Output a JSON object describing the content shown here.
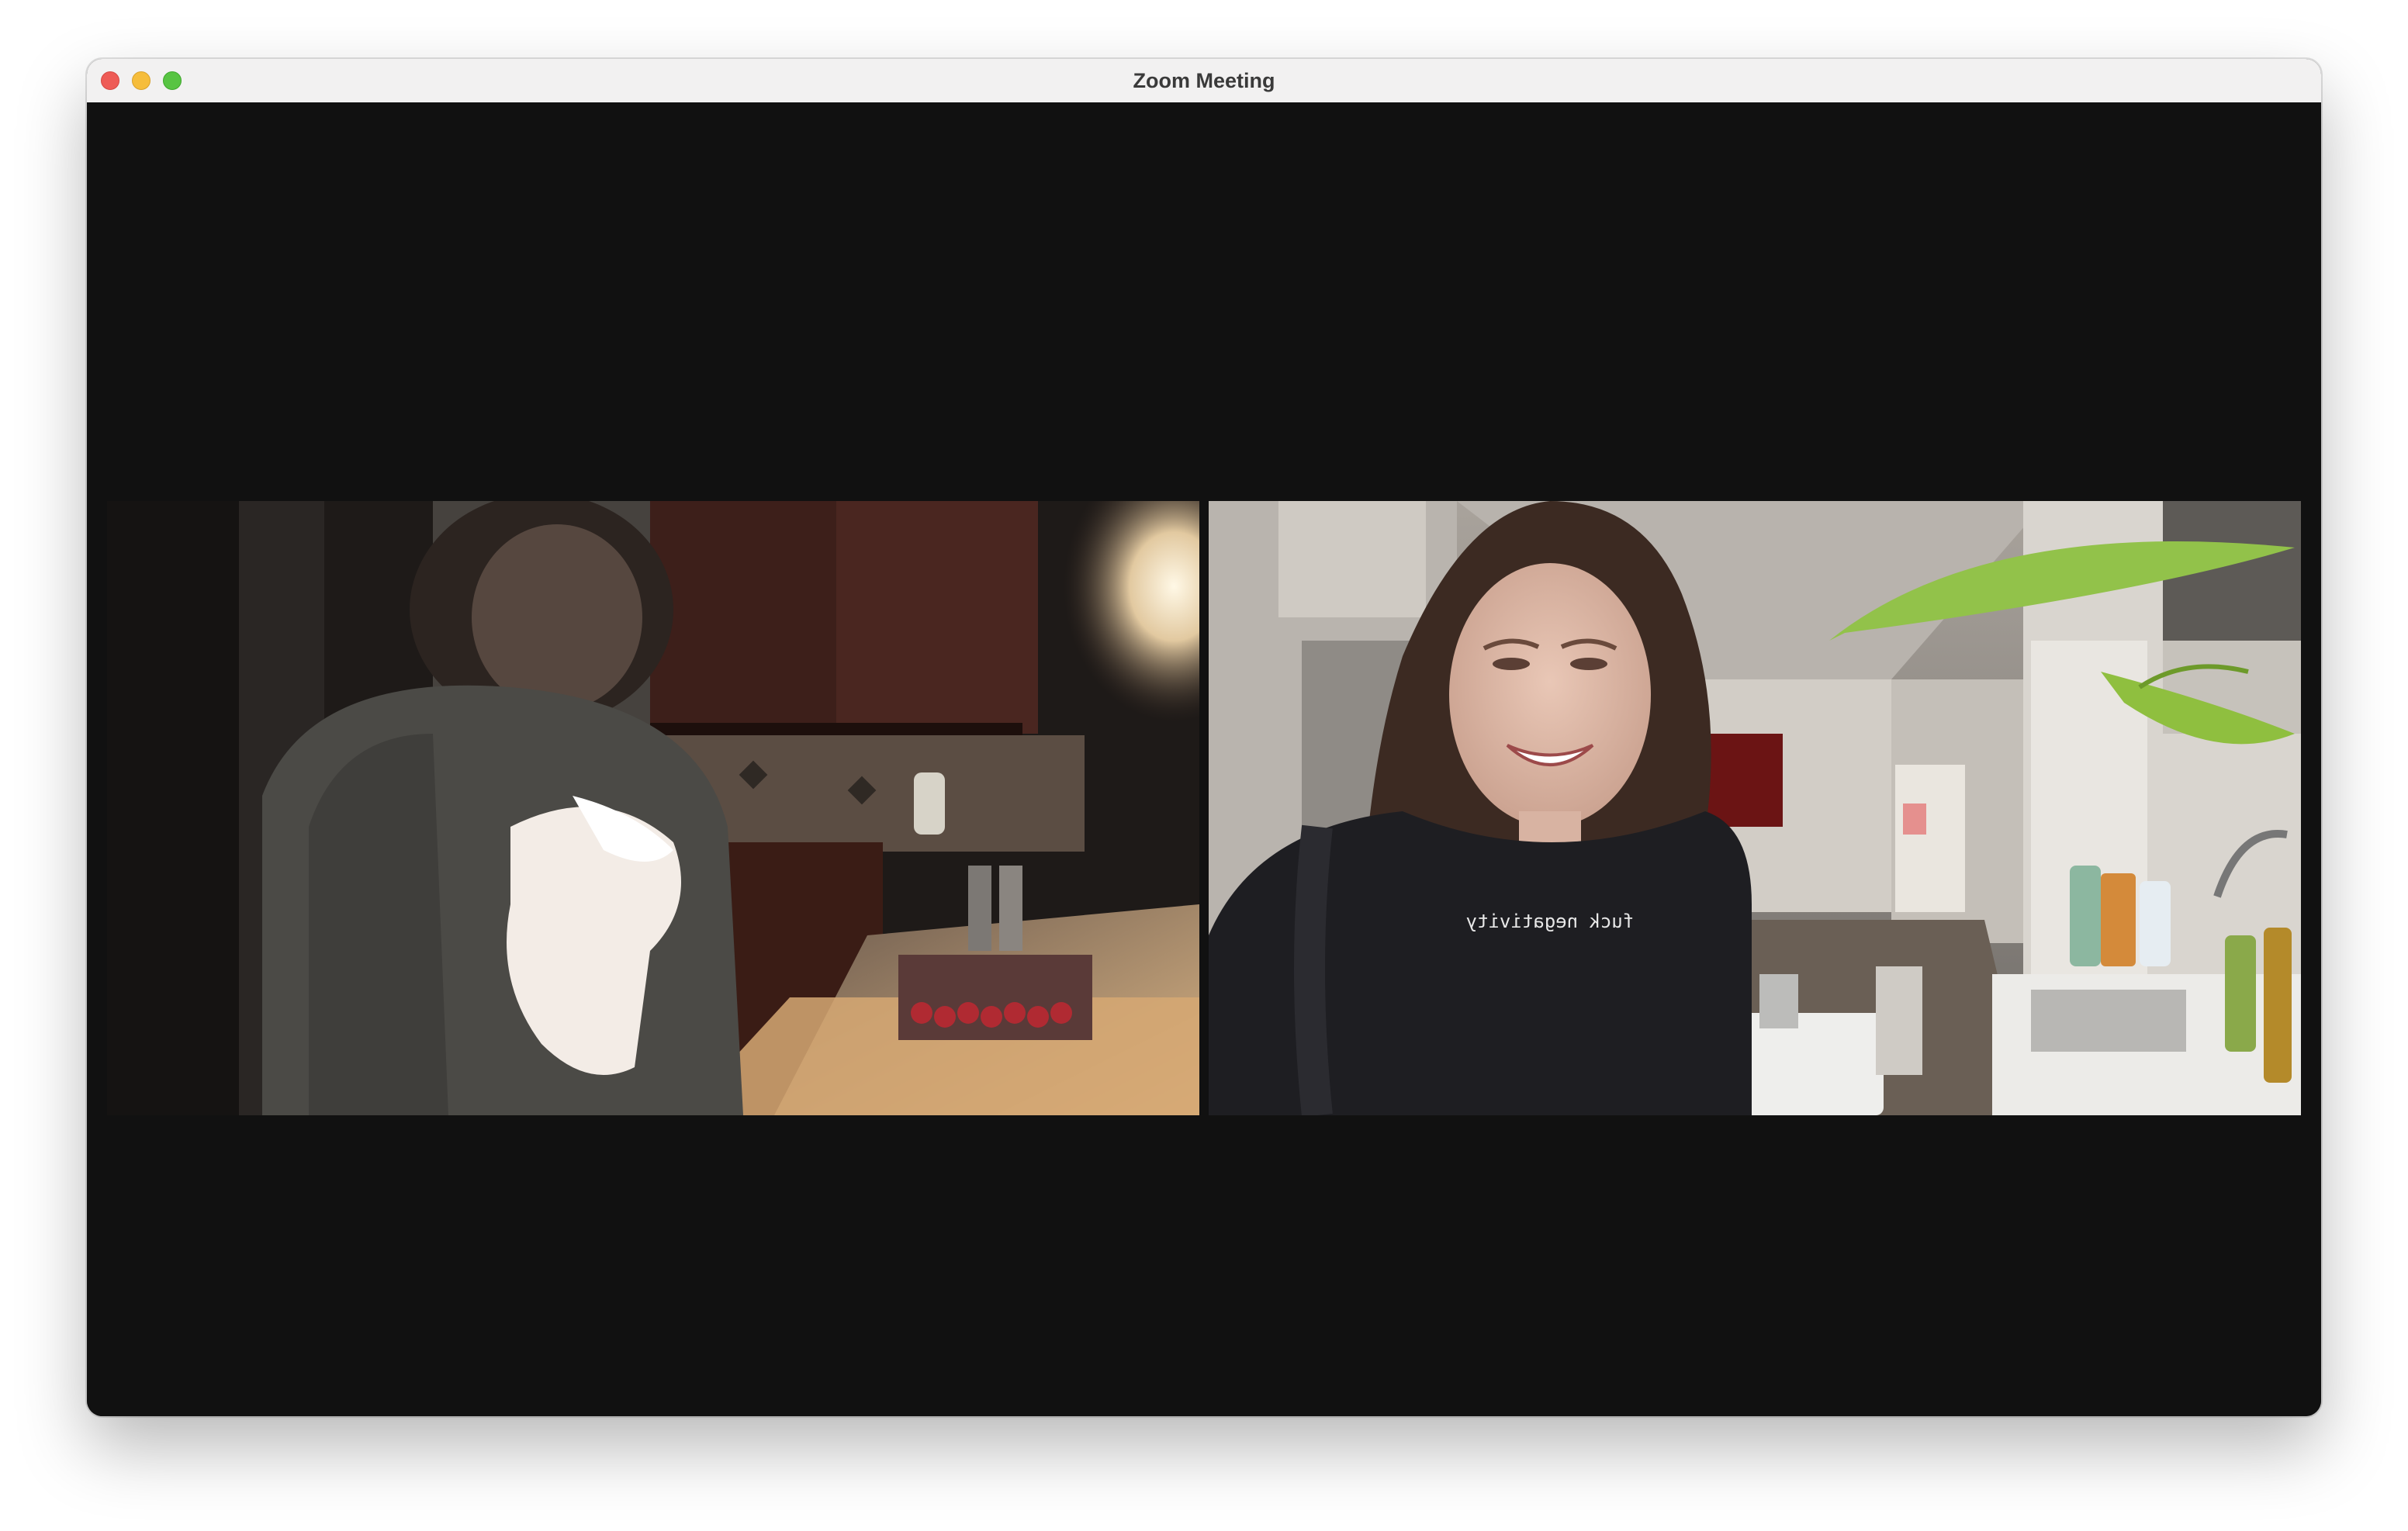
{
  "window": {
    "title": "Zoom Meeting"
  },
  "participants": [
    {
      "slot": "left",
      "scene": "kitchen-dim"
    },
    {
      "slot": "right",
      "scene": "kitchen-bright",
      "shirt_text": "fuck negativity"
    }
  ],
  "colors": {
    "stage_background": "#111111",
    "titlebar": "#f2f1f1",
    "close": "#ee5b56",
    "minimize": "#f6bd3b",
    "maximize": "#58c443"
  }
}
